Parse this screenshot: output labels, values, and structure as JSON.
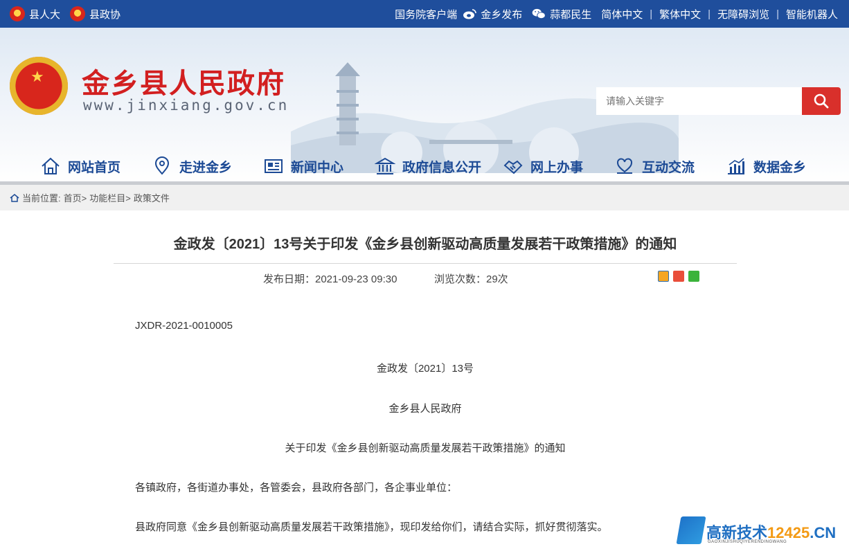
{
  "topbar": {
    "left_links": [
      {
        "label": "县人大"
      },
      {
        "label": "县政协"
      }
    ],
    "right_links": [
      {
        "label": "国务院客户端"
      },
      {
        "label": "金乡发布"
      },
      {
        "label": "蒜都民生"
      },
      {
        "label": "简体中文"
      },
      {
        "label": "繁体中文"
      },
      {
        "label": "无障碍浏览"
      },
      {
        "label": "智能机器人"
      }
    ],
    "separator": "|"
  },
  "header": {
    "site_title": "金乡县人民政府",
    "site_url": "www.jinxiang.gov.cn"
  },
  "search": {
    "placeholder": "请输入关键字"
  },
  "nav": {
    "items": [
      {
        "label": "网站首页"
      },
      {
        "label": "走进金乡"
      },
      {
        "label": "新闻中心"
      },
      {
        "label": "政府信息公开"
      },
      {
        "label": "网上办事"
      },
      {
        "label": "互动交流"
      },
      {
        "label": "数据金乡"
      }
    ]
  },
  "breadcrumb": {
    "prefix": "当前位置:",
    "items": [
      "首页>",
      "功能栏目>",
      "政策文件"
    ]
  },
  "article": {
    "title": "金政发〔2021〕13号关于印发《金乡县创新驱动高质量发展若干政策措施》的通知",
    "publish_date": "发布日期：2021-09-23 09:30",
    "views": "浏览次数：29次",
    "doc_id": "JXDR-2021-0010005",
    "doc_number": "金政发〔2021〕13号",
    "issuer": "金乡县人民政府",
    "subject": "关于印发《金乡县创新驱动高质量发展若干政策措施》的通知",
    "recipients": "各镇政府，各街道办事处，各管委会，县政府各部门，各企事业单位：",
    "body_1": "县政府同意《金乡县创新驱动高质量发展若干政策措施》，现印发给你们，请结合实际，抓好贯彻落实。"
  },
  "watermark": {
    "brand": "高新技术",
    "number": "12425",
    "domain": ".CN",
    "pinyin": "GAOXINJISHUQIYERENDINGWANG"
  },
  "colors": {
    "topbar_bg": "#1f4e9c",
    "title_red": "#d21f20",
    "nav_blue": "#1c4a95",
    "search_btn": "#d9302b"
  }
}
